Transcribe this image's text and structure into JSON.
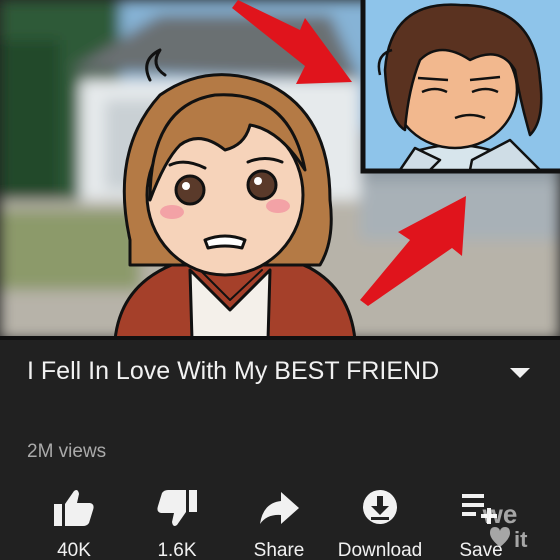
{
  "video": {
    "title": "I Fell In Love With My BEST FRIEND",
    "views": "2M views"
  },
  "actions": [
    {
      "label": "40K",
      "icon": "thumbs-up-icon"
    },
    {
      "label": "1.6K",
      "icon": "thumbs-down-icon"
    },
    {
      "label": "Share",
      "icon": "share-icon"
    },
    {
      "label": "Download",
      "icon": "download-icon"
    },
    {
      "label": "Save",
      "icon": "save-playlist-icon"
    }
  ],
  "watermark": {
    "text": "we it",
    "icon": "heart-icon"
  },
  "colors": {
    "background": "#212121",
    "text": "#f1f1f1",
    "secondary_text": "#aaaaaa",
    "arrow_red": "#e0141c"
  }
}
